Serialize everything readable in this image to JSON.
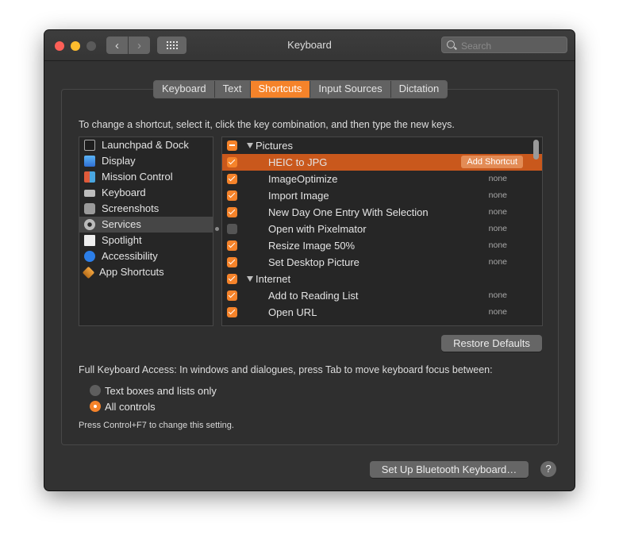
{
  "window": {
    "title": "Keyboard"
  },
  "toolbar": {
    "back_glyph": "‹",
    "forward_glyph": "›",
    "show_all_icon": "grid-icon"
  },
  "search": {
    "placeholder": "Search",
    "value": ""
  },
  "tabs": [
    {
      "label": "Keyboard",
      "active": false
    },
    {
      "label": "Text",
      "active": false
    },
    {
      "label": "Shortcuts",
      "active": true
    },
    {
      "label": "Input Sources",
      "active": false
    },
    {
      "label": "Dictation",
      "active": false
    }
  ],
  "instructions": "To change a shortcut, select it, click the key combination, and then type the new keys.",
  "sidebar": {
    "items": [
      {
        "label": "Launchpad & Dock",
        "icon": "launchpad-icon"
      },
      {
        "label": "Display",
        "icon": "display-icon"
      },
      {
        "label": "Mission Control",
        "icon": "mission-control-icon"
      },
      {
        "label": "Keyboard",
        "icon": "keyboard-icon"
      },
      {
        "label": "Screenshots",
        "icon": "screenshots-icon"
      },
      {
        "label": "Services",
        "icon": "gear-icon",
        "selected": true
      },
      {
        "label": "Spotlight",
        "icon": "spotlight-icon"
      },
      {
        "label": "Accessibility",
        "icon": "accessibility-icon"
      },
      {
        "label": "App Shortcuts",
        "icon": "app-shortcuts-icon"
      }
    ]
  },
  "shortcuts": {
    "groups": [
      {
        "label": "Pictures",
        "state": "mixed",
        "items": [
          {
            "label": "HEIC to JPG",
            "checked": true,
            "selected": true,
            "action": "Add Shortcut"
          },
          {
            "label": "ImageOptimize",
            "checked": true,
            "shortcut": "none"
          },
          {
            "label": "Import Image",
            "checked": true,
            "shortcut": "none"
          },
          {
            "label": "New Day One Entry With Selection",
            "checked": true,
            "shortcut": "none"
          },
          {
            "label": "Open with Pixelmator",
            "checked": false,
            "shortcut": "none"
          },
          {
            "label": "Resize Image 50%",
            "checked": true,
            "shortcut": "none"
          },
          {
            "label": "Set Desktop Picture",
            "checked": true,
            "shortcut": "none"
          }
        ]
      },
      {
        "label": "Internet",
        "state": "checked",
        "items": [
          {
            "label": "Add to Reading List",
            "checked": true,
            "shortcut": "none"
          },
          {
            "label": "Open URL",
            "checked": true,
            "shortcut": "none"
          }
        ]
      }
    ]
  },
  "buttons": {
    "restore_defaults": "Restore Defaults",
    "bluetooth": "Set Up Bluetooth Keyboard…",
    "help": "?"
  },
  "full_keyboard_access": {
    "text": "Full Keyboard Access: In windows and dialogues, press Tab to move keyboard focus between:",
    "options": [
      {
        "label": "Text boxes and lists only",
        "selected": false
      },
      {
        "label": "All controls",
        "selected": true
      }
    ],
    "hint": "Press Control+F7 to change this setting."
  },
  "colors": {
    "accent": "#f5832a",
    "selection": "#c9581c",
    "window_bg": "#323232"
  }
}
